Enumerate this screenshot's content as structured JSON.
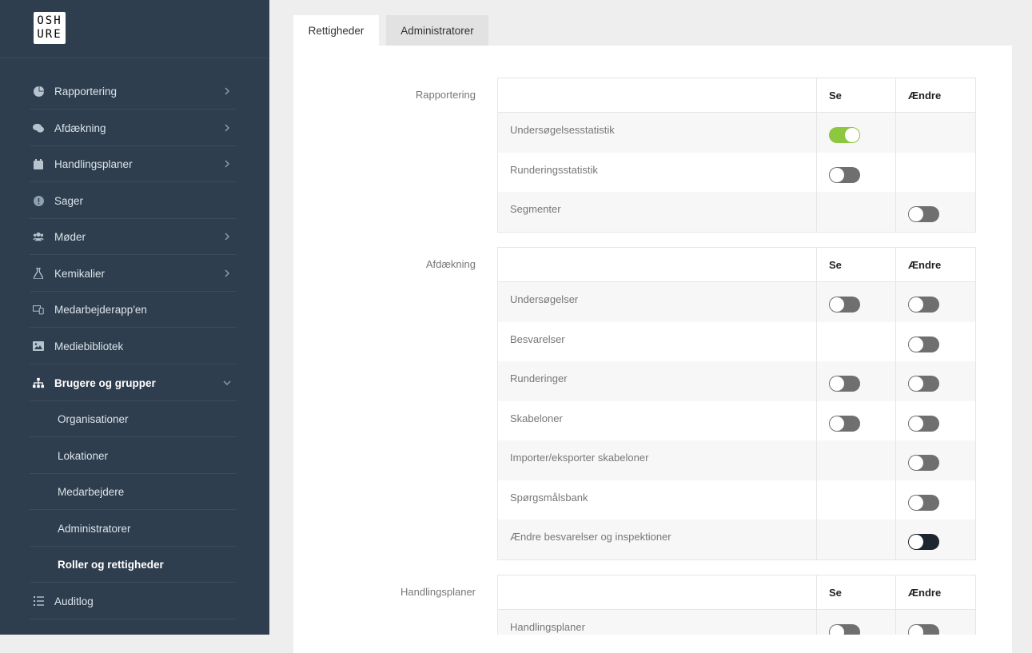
{
  "logo": {
    "line1": "OSH",
    "line2": "URE"
  },
  "sidebar": {
    "items": [
      {
        "label": "Rapportering",
        "icon": "pie-chart-icon",
        "chevron": true
      },
      {
        "label": "Afdækning",
        "icon": "chat-icon",
        "chevron": true
      },
      {
        "label": "Handlingsplaner",
        "icon": "calendar-icon",
        "chevron": true
      },
      {
        "label": "Sager",
        "icon": "alert-icon",
        "chevron": false
      },
      {
        "label": "Møder",
        "icon": "users-icon",
        "chevron": true
      },
      {
        "label": "Kemikalier",
        "icon": "flask-icon",
        "chevron": true
      },
      {
        "label": "Medarbejderapp'en",
        "icon": "devices-icon",
        "chevron": false
      },
      {
        "label": "Mediebibliotek",
        "icon": "image-icon",
        "chevron": false
      },
      {
        "label": "Brugere og grupper",
        "icon": "sitemap-icon",
        "chevron": "down",
        "active": true
      }
    ],
    "subitems": [
      {
        "label": "Organisationer"
      },
      {
        "label": "Lokationer"
      },
      {
        "label": "Medarbejdere"
      },
      {
        "label": "Administratorer"
      },
      {
        "label": "Roller og rettigheder",
        "active": true
      }
    ],
    "bottom_items": [
      {
        "label": "Auditlog",
        "icon": "list-icon"
      }
    ]
  },
  "tabs": [
    {
      "label": "Rettigheder",
      "active": true
    },
    {
      "label": "Administratorer",
      "active": false
    }
  ],
  "columns": {
    "view": "Se",
    "edit": "Ændre"
  },
  "sections": [
    {
      "label": "Rapportering",
      "rows": [
        {
          "name": "Undersøgelsesstatistik",
          "view": "on",
          "edit": null
        },
        {
          "name": "Runderingsstatistik",
          "view": "off",
          "edit": null
        },
        {
          "name": "Segmenter",
          "view": null,
          "edit": "off"
        }
      ]
    },
    {
      "label": "Afdækning",
      "rows": [
        {
          "name": "Undersøgelser",
          "view": "off",
          "edit": "off"
        },
        {
          "name": "Besvarelser",
          "view": null,
          "edit": "off"
        },
        {
          "name": "Runderinger",
          "view": "off",
          "edit": "off"
        },
        {
          "name": "Skabeloner",
          "view": "off",
          "edit": "off"
        },
        {
          "name": "Importer/eksporter skabeloner",
          "view": null,
          "edit": "off"
        },
        {
          "name": "Spørgsmålsbank",
          "view": null,
          "edit": "off"
        },
        {
          "name": "Ændre besvarelser og inspektioner",
          "view": null,
          "edit": "off-focused"
        }
      ]
    },
    {
      "label": "Handlingsplaner",
      "rows": [
        {
          "name": "Handlingsplaner",
          "view": "off",
          "edit": "off"
        }
      ]
    }
  ],
  "colors": {
    "sidebar_bg": "#2f3e4e",
    "toggle_on": "#8dc63f",
    "toggle_off": "#6f6f6f",
    "toggle_focused": "#1d2530"
  }
}
